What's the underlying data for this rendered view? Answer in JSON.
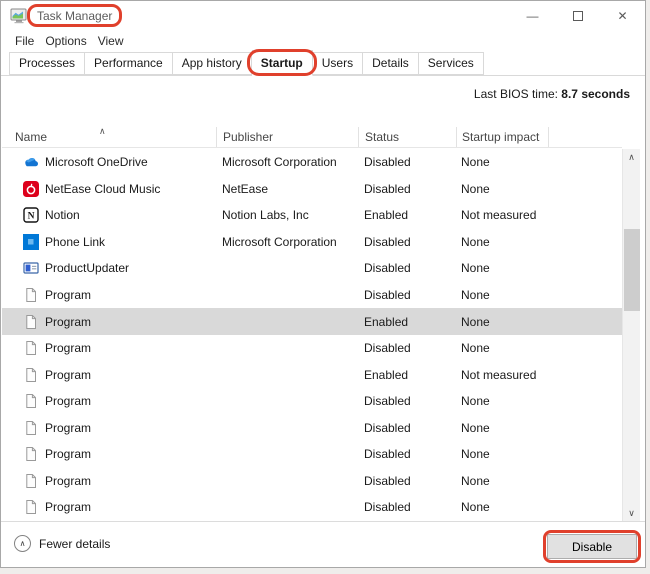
{
  "colors": {
    "annotation": "#e0402c",
    "selected_row": "#d9d9d9",
    "accent": "#0078d7"
  },
  "window": {
    "title": "Task Manager",
    "title_annotated": true
  },
  "icons": {
    "minimize": "—",
    "close": "✕",
    "sort_asc": "∧",
    "scroll_up": "∧",
    "scroll_down": "∨",
    "collapse": "∧"
  },
  "menu": {
    "items": [
      "File",
      "Options",
      "View"
    ]
  },
  "tabs": [
    {
      "label": "Processes"
    },
    {
      "label": "Performance"
    },
    {
      "label": "App history"
    },
    {
      "label": "Startup",
      "selected": true,
      "annotated": true
    },
    {
      "label": "Users"
    },
    {
      "label": "Details"
    },
    {
      "label": "Services"
    }
  ],
  "bios": {
    "label": "Last BIOS time:",
    "value": "8.7 seconds"
  },
  "table": {
    "columns": [
      "Name",
      "Publisher",
      "Status",
      "Startup impact"
    ],
    "sorted_by": "Name",
    "sort_direction": "asc",
    "rows": [
      {
        "icon": "onedrive-icon",
        "name": "Microsoft OneDrive",
        "publisher": "Microsoft Corporation",
        "status": "Disabled",
        "impact": "None"
      },
      {
        "icon": "netease-icon",
        "name": "NetEase Cloud Music",
        "publisher": "NetEase",
        "status": "Disabled",
        "impact": "None"
      },
      {
        "icon": "notion-icon",
        "name": "Notion",
        "publisher": "Notion Labs, Inc",
        "status": "Enabled",
        "impact": "Not measured"
      },
      {
        "icon": "phone-link-icon",
        "name": "Phone Link",
        "publisher": "Microsoft Corporation",
        "status": "Disabled",
        "impact": "None"
      },
      {
        "icon": "product-updater-icon",
        "name": "ProductUpdater",
        "publisher": "",
        "status": "Disabled",
        "impact": "None"
      },
      {
        "icon": "program-icon",
        "name": "Program",
        "publisher": "",
        "status": "Disabled",
        "impact": "None"
      },
      {
        "icon": "program-icon",
        "name": "Program",
        "publisher": "",
        "status": "Enabled",
        "impact": "None",
        "selected": true
      },
      {
        "icon": "program-icon",
        "name": "Program",
        "publisher": "",
        "status": "Disabled",
        "impact": "None"
      },
      {
        "icon": "program-icon",
        "name": "Program",
        "publisher": "",
        "status": "Enabled",
        "impact": "Not measured"
      },
      {
        "icon": "program-icon",
        "name": "Program",
        "publisher": "",
        "status": "Disabled",
        "impact": "None"
      },
      {
        "icon": "program-icon",
        "name": "Program",
        "publisher": "",
        "status": "Disabled",
        "impact": "None"
      },
      {
        "icon": "program-icon",
        "name": "Program",
        "publisher": "",
        "status": "Disabled",
        "impact": "None"
      },
      {
        "icon": "program-icon",
        "name": "Program",
        "publisher": "",
        "status": "Disabled",
        "impact": "None"
      },
      {
        "icon": "program-icon",
        "name": "Program",
        "publisher": "",
        "status": "Disabled",
        "impact": "None"
      }
    ]
  },
  "footer": {
    "toggle_label": "Fewer details",
    "disable_label": "Disable",
    "disable_annotated": true
  }
}
